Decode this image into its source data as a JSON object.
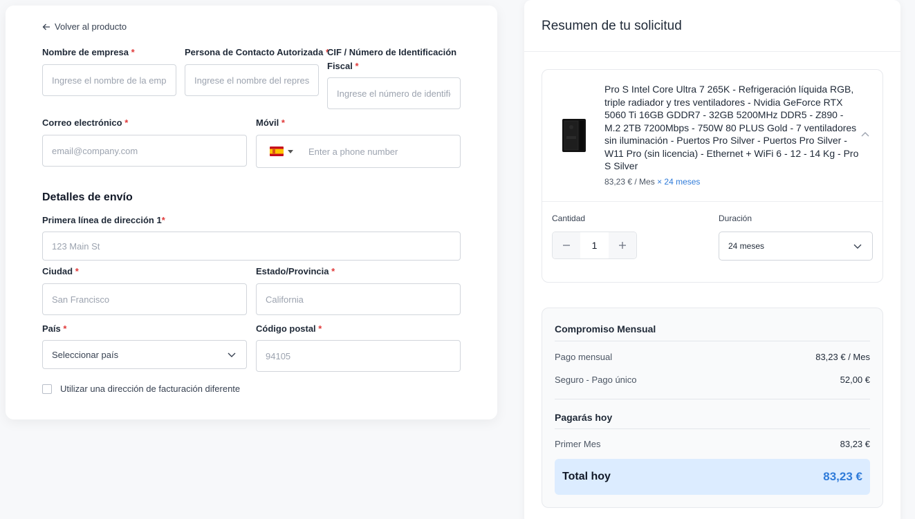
{
  "form": {
    "back_label": "Volver al producto",
    "company_name": {
      "label": "Nombre de empresa",
      "req": "*",
      "placeholder": "Ingrese el nombre de la empresa"
    },
    "contact_person": {
      "label": "Persona de Contacto Autorizada",
      "req": "*",
      "placeholder": "Ingrese el nombre del representante"
    },
    "tax_id": {
      "label_line1": "CIF / Número de Identificación",
      "label_line2": "Fiscal",
      "req": "*",
      "placeholder": "Ingrese el número de identificación"
    },
    "email": {
      "label": "Correo electrónico",
      "req": "*",
      "placeholder": "email@company.com"
    },
    "mobile": {
      "label": "Móvil",
      "req": "*",
      "placeholder": "Enter a phone number"
    },
    "shipping_title": "Detalles de envío",
    "address1": {
      "label": "Primera línea de dirección 1",
      "req": "*",
      "placeholder": "123 Main St"
    },
    "city": {
      "label": "Ciudad",
      "req": "*",
      "placeholder": "San Francisco"
    },
    "state": {
      "label": "Estado/Provincia",
      "req": "*",
      "placeholder": "California"
    },
    "country": {
      "label": "País",
      "req": "*",
      "selected": "Seleccionar país"
    },
    "postal": {
      "label": "Código postal",
      "req": "*",
      "placeholder": "94105"
    },
    "billing_checkbox_label": "Utilizar una dirección de facturación diferente"
  },
  "summary": {
    "title": "Resumen de tu solicitud",
    "product": {
      "title": "Pro S Intel Core Ultra 7 265K - Refrigeración líquida RGB, triple radiador y tres ventiladores - Nvidia GeForce RTX 5060 Ti 16GB GDDR7 - 32GB 5200MHz DDR5 - Z890 - M.2 2TB 7200Mbps - 750W 80 PLUS Gold - 7 ventiladores sin iluminación - Puertos Pro Silver - Puertos Pro Silver - W11 Pro (sin licencia) - Ethernet + WiFi 6 - 12 - 14 Kg - Pro S Silver",
      "price": "83,23 € / Mes",
      "duration_tag": "× 24 meses"
    },
    "quantity_label": "Cantidad",
    "quantity_value": "1",
    "duration_label": "Duración",
    "duration_selected": "24 meses",
    "monthly_title": "Compromiso Mensual",
    "monthly_payment_label": "Pago mensual",
    "monthly_payment_value": "83,23 € / Mes",
    "insurance_label": "Seguro - Pago único",
    "insurance_value": "52,00 €",
    "today_title": "Pagarás hoy",
    "first_month_label": "Primer Mes",
    "first_month_value": "83,23 €",
    "total_label": "Total hoy",
    "total_value": "83,23 €"
  },
  "colors": {
    "accent": "#2f7bd9",
    "required": "#e03a3a",
    "total_bg": "#dcecff"
  },
  "icons": {
    "back": "arrow-left-icon",
    "collapse": "chevron-up-icon",
    "select": "chevron-down-icon"
  }
}
